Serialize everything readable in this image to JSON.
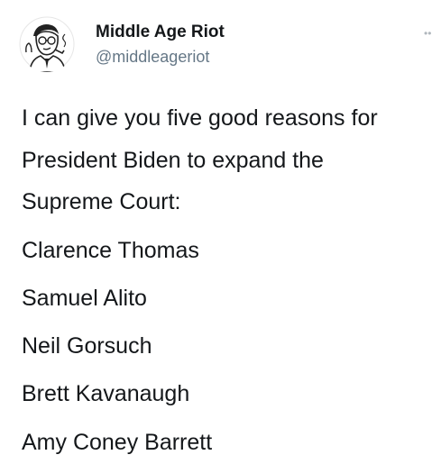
{
  "author": {
    "display_name": "Middle Age Riot",
    "handle": "@middleageriot",
    "avatar_icon": "cartoon-man-portrait-icon"
  },
  "more_icon": "more-dots-icon",
  "more_glyph": "••",
  "tweet": {
    "intro_lines": [
      "I can give you five good reasons for",
      "President Biden to expand the",
      "Supreme Court:"
    ],
    "reasons": [
      "Clarence Thomas",
      "Samuel Alito",
      "Neil Gorsuch",
      "Brett Kavanaugh",
      "Amy Coney Barrett"
    ]
  },
  "colors": {
    "text": "#14171a",
    "secondary_text": "#657786",
    "background": "#ffffff"
  }
}
